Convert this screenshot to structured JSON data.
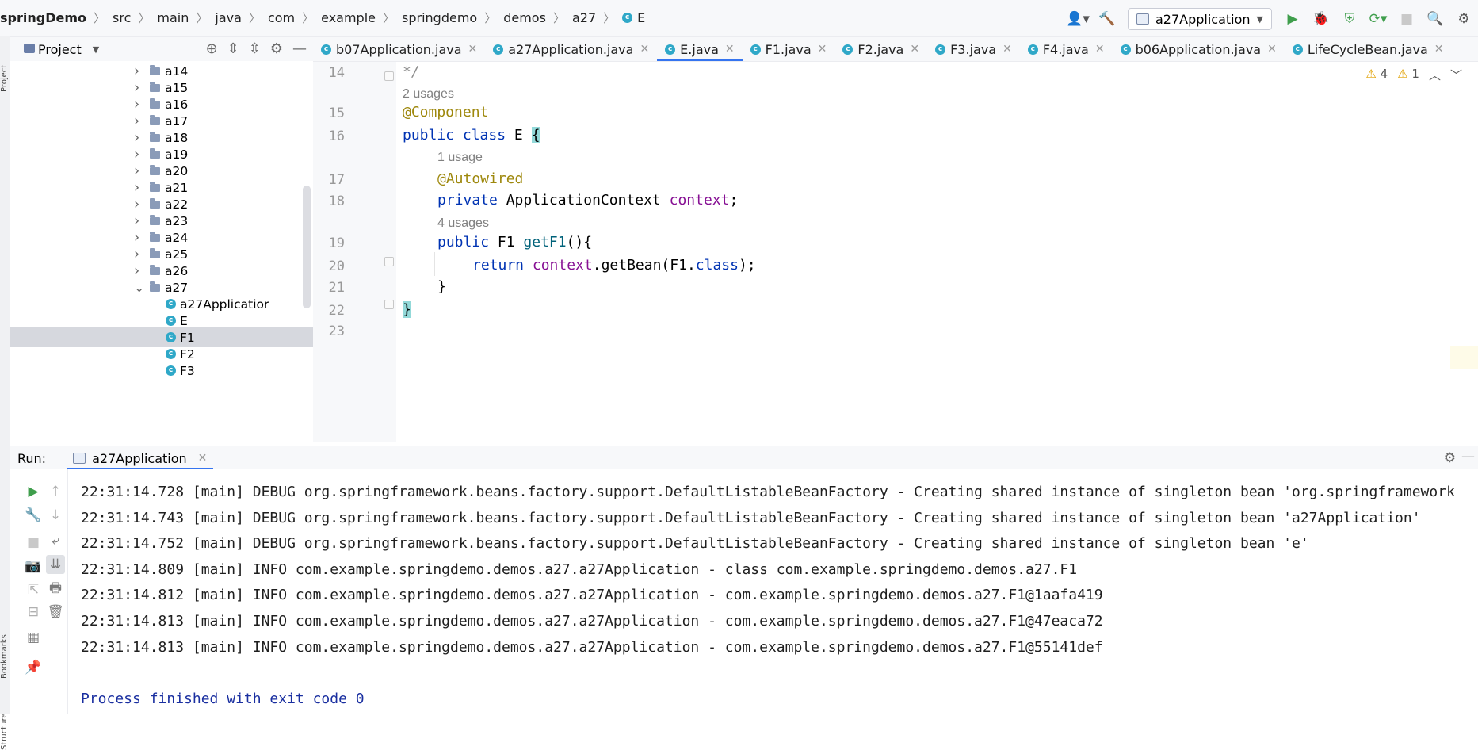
{
  "breadcrumb": [
    "springDemo",
    "src",
    "main",
    "java",
    "com",
    "example",
    "springdemo",
    "demos",
    "a27",
    "E"
  ],
  "toolbar": {
    "run_config": "a27Application"
  },
  "project_panel": {
    "title": "Project"
  },
  "tree": [
    {
      "label": "a14",
      "kind": "folder",
      "expanded": false,
      "selected": false
    },
    {
      "label": "a15",
      "kind": "folder",
      "expanded": false,
      "selected": false
    },
    {
      "label": "a16",
      "kind": "folder",
      "expanded": false,
      "selected": false
    },
    {
      "label": "a17",
      "kind": "folder",
      "expanded": false,
      "selected": false
    },
    {
      "label": "a18",
      "kind": "folder",
      "expanded": false,
      "selected": false
    },
    {
      "label": "a19",
      "kind": "folder",
      "expanded": false,
      "selected": false
    },
    {
      "label": "a20",
      "kind": "folder",
      "expanded": false,
      "selected": false
    },
    {
      "label": "a21",
      "kind": "folder",
      "expanded": false,
      "selected": false
    },
    {
      "label": "a22",
      "kind": "folder",
      "expanded": false,
      "selected": false
    },
    {
      "label": "a23",
      "kind": "folder",
      "expanded": false,
      "selected": false
    },
    {
      "label": "a24",
      "kind": "folder",
      "expanded": false,
      "selected": false
    },
    {
      "label": "a25",
      "kind": "folder",
      "expanded": false,
      "selected": false
    },
    {
      "label": "a26",
      "kind": "folder",
      "expanded": false,
      "selected": false
    },
    {
      "label": "a27",
      "kind": "folder",
      "expanded": true,
      "selected": false
    },
    {
      "label": "a27Applicatior",
      "kind": "class",
      "expanded": false,
      "selected": false
    },
    {
      "label": "E",
      "kind": "class",
      "expanded": false,
      "selected": false
    },
    {
      "label": "F1",
      "kind": "class",
      "expanded": false,
      "selected": true
    },
    {
      "label": "F2",
      "kind": "class",
      "expanded": false,
      "selected": false
    },
    {
      "label": "F3",
      "kind": "class",
      "expanded": false,
      "selected": false
    }
  ],
  "tabs": [
    {
      "label": "b07Application.java",
      "active": false
    },
    {
      "label": "a27Application.java",
      "active": false
    },
    {
      "label": "E.java",
      "active": true
    },
    {
      "label": "F1.java",
      "active": false
    },
    {
      "label": "F2.java",
      "active": false
    },
    {
      "label": "F3.java",
      "active": false
    },
    {
      "label": "F4.java",
      "active": false
    },
    {
      "label": "b06Application.java",
      "active": false
    },
    {
      "label": "LifeCycleBean.java",
      "active": false
    }
  ],
  "editor": {
    "warnings": {
      "warn_count": "4",
      "weak_count": "1"
    },
    "lines": [
      {
        "num": "14",
        "type": "code",
        "tokens": [
          {
            "t": "*/",
            "c": "cmt"
          }
        ]
      },
      {
        "num": "",
        "type": "hint",
        "text": "2 usages"
      },
      {
        "num": "15",
        "type": "code",
        "tokens": [
          {
            "t": "@Component",
            "c": "ann"
          }
        ]
      },
      {
        "num": "16",
        "type": "code",
        "tokens": [
          {
            "t": "public",
            "c": "kw"
          },
          {
            "t": " ",
            "c": ""
          },
          {
            "t": "class",
            "c": "kw"
          },
          {
            "t": " E ",
            "c": ""
          },
          {
            "t": "{",
            "c": "brace"
          }
        ]
      },
      {
        "num": "",
        "type": "hint",
        "indent": 1,
        "text": "1 usage"
      },
      {
        "num": "17",
        "type": "code",
        "indent": 1,
        "tokens": [
          {
            "t": "@Autowired",
            "c": "ann"
          }
        ]
      },
      {
        "num": "18",
        "type": "code",
        "indent": 1,
        "tokens": [
          {
            "t": "private",
            "c": "kw"
          },
          {
            "t": " ApplicationContext ",
            "c": ""
          },
          {
            "t": "context",
            "c": "fld"
          },
          {
            "t": ";",
            "c": ""
          }
        ]
      },
      {
        "num": "",
        "type": "hint",
        "indent": 1,
        "text": "4 usages"
      },
      {
        "num": "19",
        "type": "code",
        "indent": 1,
        "tokens": [
          {
            "t": "public",
            "c": "kw"
          },
          {
            "t": " F1 ",
            "c": ""
          },
          {
            "t": "getF1",
            "c": "fn"
          },
          {
            "t": "(){",
            "c": ""
          }
        ]
      },
      {
        "num": "20",
        "type": "code",
        "indent": 2,
        "tokens": [
          {
            "t": "return",
            "c": "kw"
          },
          {
            "t": " ",
            "c": ""
          },
          {
            "t": "context",
            "c": "fld"
          },
          {
            "t": ".getBean(F1.",
            "c": ""
          },
          {
            "t": "class",
            "c": "kw"
          },
          {
            "t": ");",
            "c": ""
          }
        ]
      },
      {
        "num": "21",
        "type": "code",
        "indent": 1,
        "tokens": [
          {
            "t": "}",
            "c": ""
          }
        ]
      },
      {
        "num": "22",
        "type": "code",
        "tokens": [
          {
            "t": "}",
            "c": "brace"
          }
        ]
      },
      {
        "num": "23",
        "type": "code",
        "tokens": []
      }
    ]
  },
  "run_panel": {
    "label": "Run:",
    "tab": "a27Application",
    "log": [
      "22:31:14.728 [main] DEBUG org.springframework.beans.factory.support.DefaultListableBeanFactory - Creating shared instance of singleton bean 'org.springframework",
      "22:31:14.743 [main] DEBUG org.springframework.beans.factory.support.DefaultListableBeanFactory - Creating shared instance of singleton bean 'a27Application'",
      "22:31:14.752 [main] DEBUG org.springframework.beans.factory.support.DefaultListableBeanFactory - Creating shared instance of singleton bean 'e'",
      "22:31:14.809 [main] INFO com.example.springdemo.demos.a27.a27Application - class com.example.springdemo.demos.a27.F1",
      "22:31:14.812 [main] INFO com.example.springdemo.demos.a27.a27Application - com.example.springdemo.demos.a27.F1@1aafa419",
      "22:31:14.813 [main] INFO com.example.springdemo.demos.a27.a27Application - com.example.springdemo.demos.a27.F1@47eaca72",
      "22:31:14.813 [main] INFO com.example.springdemo.demos.a27.a27Application - com.example.springdemo.demos.a27.F1@55141def"
    ],
    "exit_message": "Process finished with exit code 0"
  }
}
